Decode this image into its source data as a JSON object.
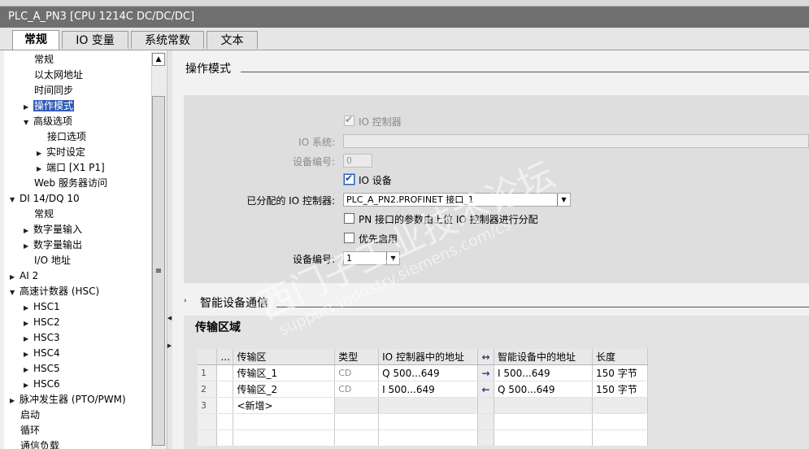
{
  "window": {
    "title": "PLC_A_PN3 [CPU 1214C DC/DC/DC]"
  },
  "tabs": [
    "常规",
    "IO 变量",
    "系统常数",
    "文本"
  ],
  "sidebar": {
    "items": [
      {
        "label": "常规"
      },
      {
        "label": "以太网地址"
      },
      {
        "label": "时间同步"
      },
      {
        "label": "操作模式"
      },
      {
        "label": "高级选项"
      },
      {
        "label": "接口选项"
      },
      {
        "label": "实时设定"
      },
      {
        "label": "端口 [X1 P1]"
      },
      {
        "label": "Web 服务器访问"
      },
      {
        "label": "DI 14/DQ 10"
      },
      {
        "label": "常规"
      },
      {
        "label": "数字量输入"
      },
      {
        "label": "数字量输出"
      },
      {
        "label": "I/O 地址"
      },
      {
        "label": "AI 2"
      },
      {
        "label": "高速计数器 (HSC)"
      },
      {
        "label": "HSC1"
      },
      {
        "label": "HSC2"
      },
      {
        "label": "HSC3"
      },
      {
        "label": "HSC4"
      },
      {
        "label": "HSC5"
      },
      {
        "label": "HSC6"
      },
      {
        "label": "脉冲发生器 (PTO/PWM)"
      },
      {
        "label": "启动"
      },
      {
        "label": "循环"
      },
      {
        "label": "通信负载"
      }
    ]
  },
  "operating_mode": {
    "title": "操作模式",
    "io_controller_label": "IO 控制器",
    "io_system_label": "IO 系统:",
    "device_number_label": "设备编号:",
    "device_number_value": "0",
    "io_device_label": "IO 设备",
    "assigned_controller_label": "已分配的 IO 控制器:",
    "assigned_controller_value": "PLC_A_PN2.PROFINET 接口_1",
    "pn_param_label": "PN 接口的参数由上位 IO 控制器进行分配",
    "priority_label": "优先启用",
    "device_number2_label": "设备编号:",
    "device_number2_value": "1"
  },
  "smart_device": {
    "title": "智能设备通信",
    "transfer_title": "传输区域",
    "columns": [
      "...",
      "传输区",
      "类型",
      "IO 控制器中的地址",
      "↔",
      "智能设备中的地址",
      "长度"
    ],
    "rows": [
      {
        "num": "1",
        "name": "传输区_1",
        "type": "CD",
        "ctrl_addr": "Q 500...649",
        "dir": "→",
        "dev_addr": "I 500...649",
        "len": "150 字节"
      },
      {
        "num": "2",
        "name": "传输区_2",
        "type": "CD",
        "ctrl_addr": "I 500...649",
        "dir": "←",
        "dev_addr": "Q 500...649",
        "len": "150 字节"
      },
      {
        "num": "3",
        "name": "<新增>",
        "type": "",
        "ctrl_addr": "",
        "dir": "",
        "dev_addr": "",
        "len": ""
      }
    ]
  },
  "watermark": {
    "line1": "西门子工业技术论坛",
    "line2": "support.industry.siemens.com/cs"
  }
}
